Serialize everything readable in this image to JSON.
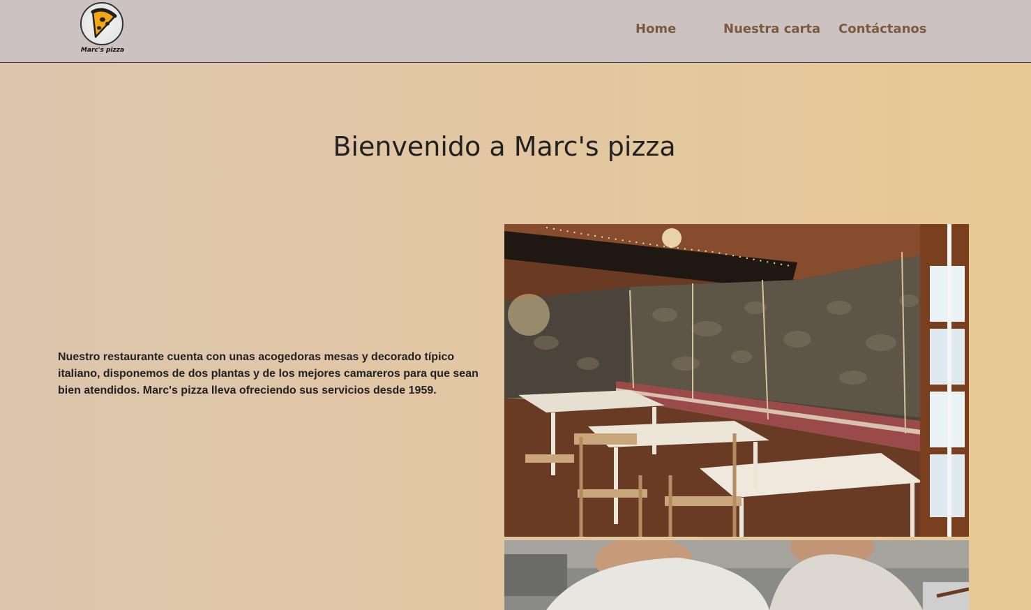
{
  "header": {
    "logo_text": "Marc's pizza",
    "nav": [
      {
        "label": "Home"
      },
      {
        "label": "Nuestra carta"
      },
      {
        "label": "Contáctanos"
      }
    ]
  },
  "main": {
    "title": "Bienvenido a Marc's pizza",
    "description": "Nuestro restaurante cuenta con unas acogedoras mesas y decorado típico italiano, disponemos de dos plantas y de los mejores camareros para que sean bien atendidos. Marc's pizza lleva ofreciendo sus servicios desde 1959."
  },
  "icons": {
    "logo": "pizza-slice-icon"
  },
  "colors": {
    "navbar_bg": "#cdc2c2",
    "nav_link": "#7b5b3d",
    "page_bg_left": "#dcc5ad",
    "page_bg_right": "#e8c995",
    "text": "#222222"
  }
}
